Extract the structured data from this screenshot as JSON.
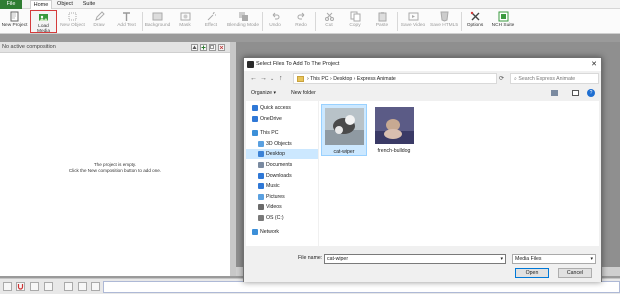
{
  "menu": {
    "file": "File",
    "tabs": [
      "Home",
      "Object",
      "Suite"
    ]
  },
  "toolbar": {
    "new_project": "New Project",
    "load_media": "Load Media",
    "new_object": "New Object",
    "draw": "Draw",
    "add_text": "Add Text",
    "background": "Background",
    "mask": "Mask",
    "effect": "Effect",
    "blending_mode": "Blending Mode",
    "undo": "Undo",
    "redo": "Redo",
    "cut": "Cut",
    "copy": "Copy",
    "paste": "Paste",
    "save_video": "Save Video",
    "save_html5": "Save HTML5",
    "options": "Options",
    "nch_suite": "NCH Suite"
  },
  "left_panel": {
    "title": "No active composition",
    "empty_line1": "The project is empty.",
    "empty_line2": "Click the New composition button to add one."
  },
  "dialog": {
    "title": "Select Files To Add To The Project",
    "breadcrumb": [
      "This PC",
      "Desktop",
      "Express Animate"
    ],
    "breadcrumb_sep": "›",
    "search_placeholder": "Search Express Animate",
    "organize": "Organize",
    "new_folder": "New folder",
    "nav_items": [
      {
        "label": "Quick access",
        "color": "#2f78d6"
      },
      {
        "label": "OneDrive",
        "color": "#2f78d6"
      },
      {
        "label": "This PC",
        "color": "#3c8fd8"
      },
      {
        "label": "3D Objects",
        "color": "#5aa0e0"
      },
      {
        "label": "Desktop",
        "color": "#3b82d6"
      },
      {
        "label": "Documents",
        "color": "#7a8aa0"
      },
      {
        "label": "Downloads",
        "color": "#2f78d6"
      },
      {
        "label": "Music",
        "color": "#2f78d6"
      },
      {
        "label": "Pictures",
        "color": "#5aa0e0"
      },
      {
        "label": "Videos",
        "color": "#6a6a6a"
      },
      {
        "label": "OS (C:)",
        "color": "#7a7a7a"
      },
      {
        "label": "Network",
        "color": "#3c8fd8"
      }
    ],
    "files": [
      {
        "name": "cat-wiper",
        "selected": true
      },
      {
        "name": "french-bulldog",
        "selected": false
      }
    ],
    "file_name_label": "File name:",
    "file_name_value": "cat-wiper",
    "file_type": "Media Files",
    "open_label": "Open",
    "cancel_label": "Cancel"
  },
  "colors": {
    "accent": "#2f7d32",
    "selection": "#cce8ff",
    "highlight_border": "#d43b3b"
  }
}
